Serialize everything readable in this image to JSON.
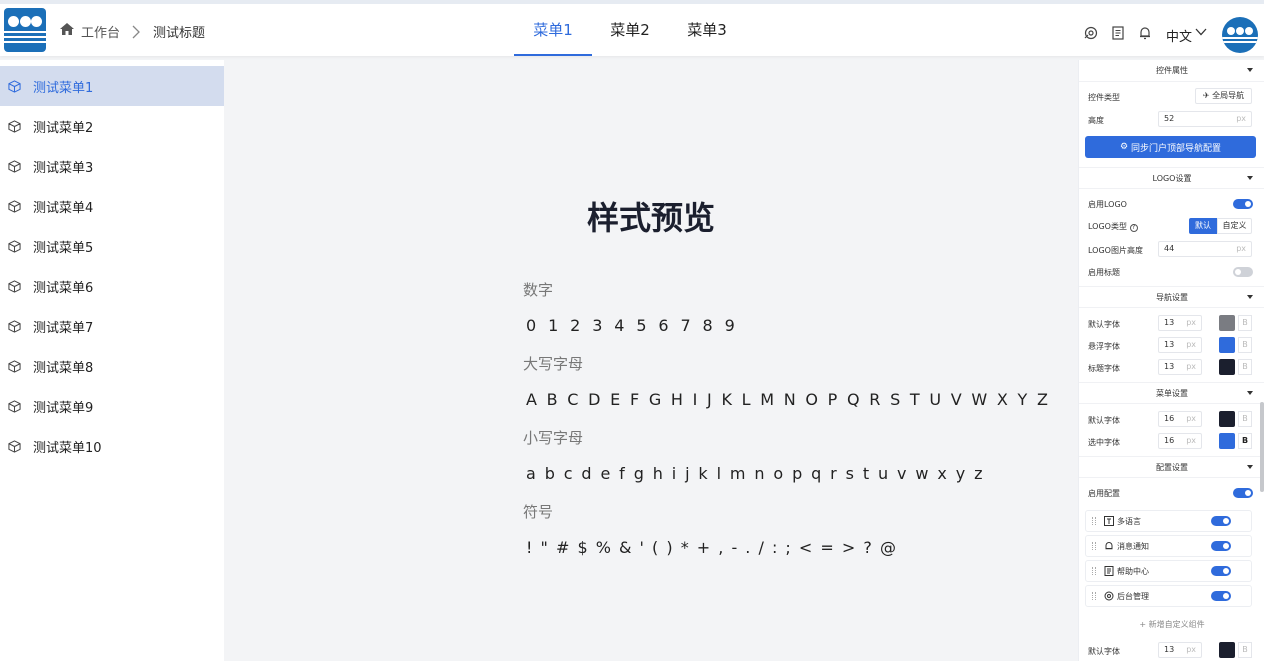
{
  "header": {
    "breadcrumb": [
      "工作台",
      "测试标题"
    ],
    "breadcrumb_sep": ">",
    "nav": [
      "菜单1",
      "菜单2",
      "菜单3"
    ],
    "nav_active": 0,
    "lang": "中文",
    "accent": "#2f6bdc"
  },
  "sidebar": {
    "items": [
      "测试菜单1",
      "测试菜单2",
      "测试菜单3",
      "测试菜单4",
      "测试菜单5",
      "测试菜单6",
      "测试菜单7",
      "测试菜单8",
      "测试菜单9",
      "测试菜单10"
    ],
    "active": 0
  },
  "preview": {
    "title": "样式预览",
    "sections": [
      {
        "label": "数字",
        "text": "0 1 2 3 4 5 6 7 8 9"
      },
      {
        "label": "大写字母",
        "text": "A B C D E F G H I J K L M N O P Q R S T U V W X Y Z"
      },
      {
        "label": "小写字母",
        "text": "a b c d e f g h i j k l m n o p q r s t u v w x y z"
      },
      {
        "label": "符号",
        "text": "! \" # $ % & ' ( ) * + , - . / : ; < = > ? @"
      }
    ]
  },
  "panel": {
    "control": {
      "section": "控件属性",
      "type_label": "控件类型",
      "type_button": "全局导航",
      "height_label": "高度",
      "height_value": "52",
      "unit": "px",
      "sync_button": "同步门户顶部导航配置"
    },
    "logo": {
      "section": "LOGO设置",
      "enable_label": "启用LOGO",
      "enable": true,
      "type_label": "LOGO类型",
      "type_options": [
        "默认",
        "自定义"
      ],
      "img_height_label": "LOGO图片高度",
      "img_height_value": "44",
      "title_label": "启用标题",
      "title_enable": false
    },
    "nav": {
      "section": "导航设置",
      "rows": [
        {
          "label": "默认字体",
          "size": "13",
          "color": "#7a7c82",
          "bold": false
        },
        {
          "label": "悬浮字体",
          "size": "13",
          "color": "#2f6bdc",
          "bold": false
        },
        {
          "label": "标题字体",
          "size": "13",
          "color": "#1b1f2e",
          "bold": false
        }
      ]
    },
    "menu": {
      "section": "菜单设置",
      "rows": [
        {
          "label": "默认字体",
          "size": "16",
          "color": "#1b1f2e",
          "bold": false
        },
        {
          "label": "选中字体",
          "size": "16",
          "color": "#2f6bdc",
          "bold": true
        }
      ]
    },
    "config": {
      "section": "配置设置",
      "enable_label": "启用配置",
      "enable": true,
      "items": [
        "多语言",
        "消息通知",
        "帮助中心",
        "后台管理"
      ],
      "add_label": "+ 新增自定义组件",
      "bottom_row": {
        "label": "默认字体",
        "size": "13",
        "color": "#1b1f2e"
      }
    },
    "bold_letter": "B"
  }
}
